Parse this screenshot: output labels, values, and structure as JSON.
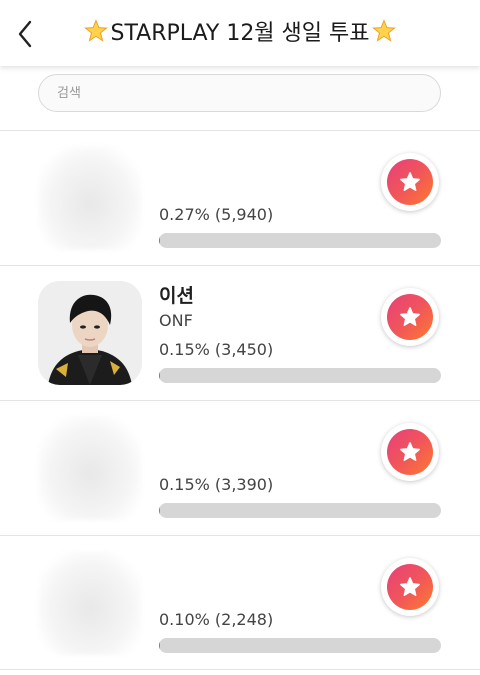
{
  "header": {
    "title": "STARPLAY 12월 생일 투표",
    "left_icon": "star-emoji-icon",
    "right_icon": "star-emoji-icon",
    "back_icon": "chevron-left-icon"
  },
  "search": {
    "placeholder": "검색",
    "value": ""
  },
  "colors": {
    "accent_start": "#e6335f",
    "accent_end": "#ff6a3d",
    "bar_track": "#d6d6d6"
  },
  "items": [
    {
      "name": "",
      "group": "",
      "percent_text": "0.27% (5,940)",
      "progress_percent": 0.27,
      "avatar": "blurred"
    },
    {
      "name": "이션",
      "group": "ONF",
      "percent_text": "0.15% (3,450)",
      "progress_percent": 0.15,
      "avatar": "photo"
    },
    {
      "name": "",
      "group": "",
      "percent_text": "0.15% (3,390)",
      "progress_percent": 0.15,
      "avatar": "blurred"
    },
    {
      "name": "",
      "group": "",
      "percent_text": "0.10% (2,248)",
      "progress_percent": 0.1,
      "avatar": "blurred"
    }
  ]
}
